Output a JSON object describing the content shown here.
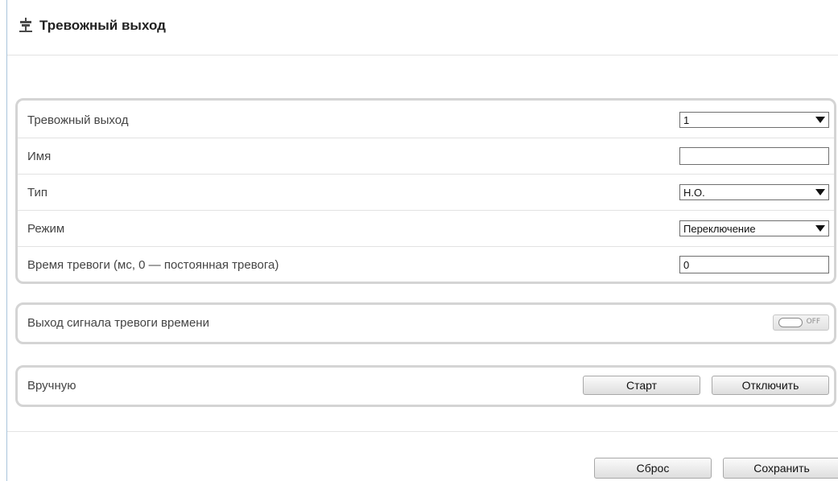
{
  "header": {
    "title": "Тревожный выход",
    "icon": "alarm-output-icon"
  },
  "settings": {
    "alarm_output": {
      "label": "Тревожный выход",
      "value": "1"
    },
    "name": {
      "label": "Имя",
      "value": ""
    },
    "type": {
      "label": "Тип",
      "value": "Н.О."
    },
    "mode": {
      "label": "Режим",
      "value": "Переключение"
    },
    "alarm_time": {
      "label": "Время тревоги (мс, 0 — постоянная тревога)",
      "value": "0"
    }
  },
  "schedule": {
    "label": "Выход сигнала тревоги времени",
    "toggle_state": "OFF"
  },
  "manual": {
    "label": "Вручную",
    "start_label": "Старт",
    "stop_label": "Отключить"
  },
  "footer": {
    "reset_label": "Сброс",
    "save_label": "Сохранить"
  }
}
